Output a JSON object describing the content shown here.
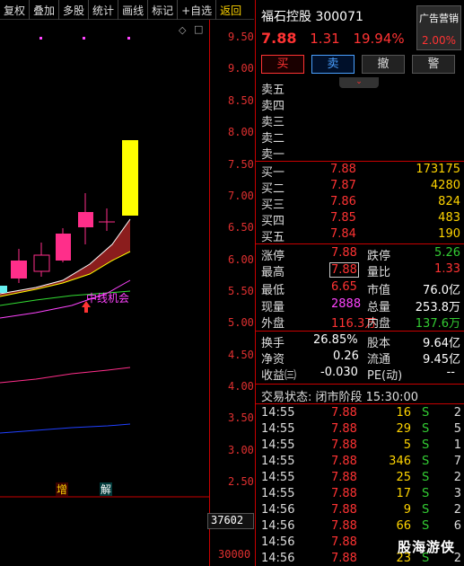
{
  "toolbar": {
    "buttons": [
      "复权",
      "叠加",
      "多股",
      "统计",
      "画线",
      "标记",
      "+自选",
      "返回"
    ]
  },
  "chart": {
    "y_ticks": [
      "9.50",
      "9.00",
      "8.50",
      "8.00",
      "7.50",
      "7.00",
      "6.50",
      "6.00",
      "5.50",
      "5.00",
      "4.50",
      "4.00",
      "3.50",
      "3.00",
      "2.50"
    ],
    "annotation": "中线机会",
    "markers": [
      "增",
      "解"
    ],
    "volume_value": "37602",
    "volume_tick": "30000",
    "colors": {
      "up": "#ff2e8a",
      "limit_up": "#ffff00",
      "axis": "#e03030"
    }
  },
  "stock": {
    "name_code": "福石控股 300071",
    "price": "7.88",
    "change": "1.31",
    "change_pct": "19.94%",
    "industry": "广告营销",
    "industry_pct": "2.00%"
  },
  "trade_buttons": [
    "买",
    "卖",
    "撤",
    "警"
  ],
  "asks": [
    {
      "label": "卖五"
    },
    {
      "label": "卖四"
    },
    {
      "label": "卖三"
    },
    {
      "label": "卖二"
    },
    {
      "label": "卖一"
    }
  ],
  "bids": [
    {
      "label": "买一",
      "price": "7.88",
      "volume": "173175"
    },
    {
      "label": "买二",
      "price": "7.87",
      "volume": "4280"
    },
    {
      "label": "买三",
      "price": "7.86",
      "volume": "824"
    },
    {
      "label": "买四",
      "price": "7.85",
      "volume": "483"
    },
    {
      "label": "买五",
      "price": "7.84",
      "volume": "190"
    }
  ],
  "stats": {
    "limit_up_label": "涨停",
    "limit_up": "7.88",
    "limit_down_label": "跌停",
    "limit_down": "5.26",
    "high_label": "最高",
    "high": "7.88",
    "vol_ratio_label": "量比",
    "vol_ratio": "1.33",
    "low_label": "最低",
    "low": "6.65",
    "mkt_cap_label": "市值",
    "mkt_cap": "76.0亿",
    "current_label": "现量",
    "current": "2888",
    "total_vol_label": "总量",
    "total_vol": "253.8万",
    "outer_label": "外盘",
    "outer": "116.3万",
    "inner_label": "内盘",
    "inner": "137.6万",
    "turnover_label": "换手",
    "turnover": "26.85%",
    "capital_label": "股本",
    "capital": "9.64亿",
    "nav_label": "净资",
    "nav": "0.26",
    "float_label": "流通",
    "float": "9.45亿",
    "eps_label": "收益㈢",
    "eps": "-0.030",
    "pe_label": "PE(动)",
    "pe": "--"
  },
  "ticks_header": "交易状态: 闭市阶段 15:30:00",
  "ticks": [
    {
      "time": "14:55",
      "price": "7.88",
      "vol": "16",
      "side": "S",
      "n": "2"
    },
    {
      "time": "14:55",
      "price": "7.88",
      "vol": "29",
      "side": "S",
      "n": "5"
    },
    {
      "time": "14:55",
      "price": "7.88",
      "vol": "5",
      "side": "S",
      "n": "1"
    },
    {
      "time": "14:55",
      "price": "7.88",
      "vol": "346",
      "side": "S",
      "n": "7"
    },
    {
      "time": "14:55",
      "price": "7.88",
      "vol": "25",
      "side": "S",
      "n": "2"
    },
    {
      "time": "14:55",
      "price": "7.88",
      "vol": "17",
      "side": "S",
      "n": "3"
    },
    {
      "time": "14:56",
      "price": "7.88",
      "vol": "9",
      "side": "S",
      "n": "2"
    },
    {
      "time": "14:56",
      "price": "7.88",
      "vol": "66",
      "side": "S",
      "n": "6"
    },
    {
      "time": "14:56",
      "price": "7.88",
      "vol": "",
      "side": "",
      "n": ""
    },
    {
      "time": "14:56",
      "price": "7.88",
      "vol": "23",
      "side": "S",
      "n": "2"
    }
  ],
  "watermark": "股海游侠"
}
